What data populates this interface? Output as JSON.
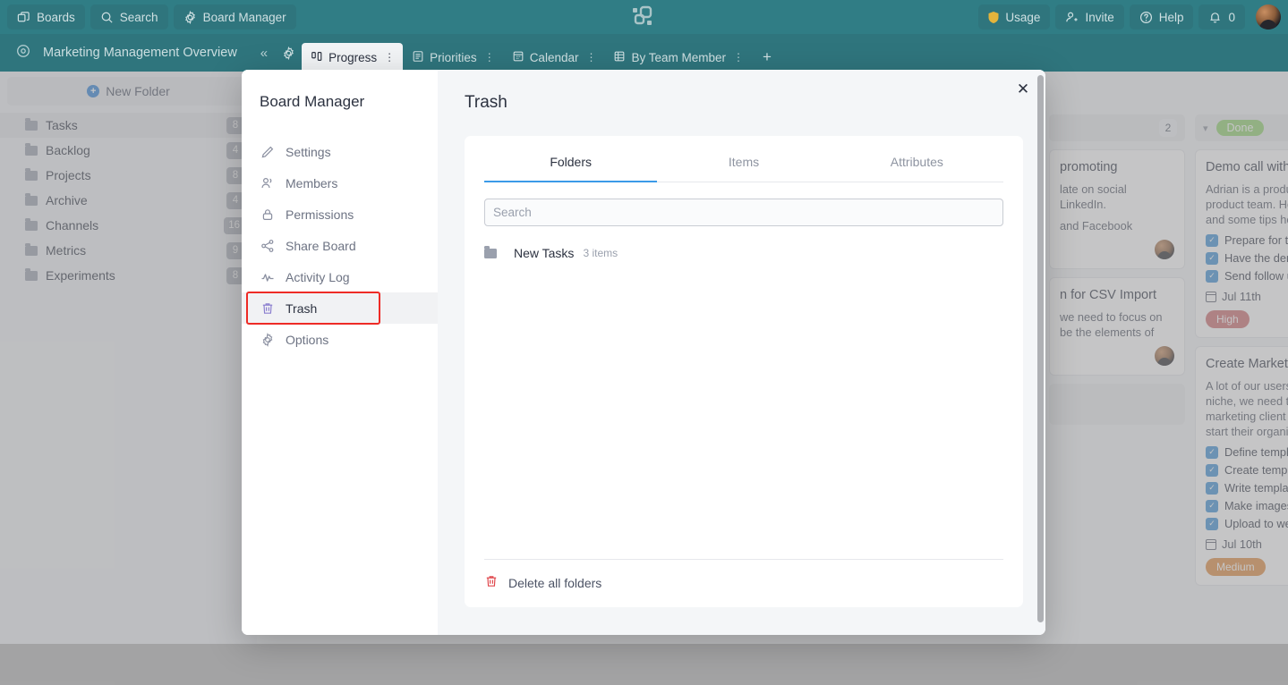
{
  "topbar": {
    "buttons": [
      {
        "label": "Boards",
        "icon": "boards-icon"
      },
      {
        "label": "Search",
        "icon": "search-icon"
      },
      {
        "label": "Board Manager",
        "icon": "gear-icon"
      }
    ],
    "right": [
      {
        "label": "Usage",
        "icon": "shield-icon"
      },
      {
        "label": "Invite",
        "icon": "user-plus-icon"
      },
      {
        "label": "Help",
        "icon": "question-circle-icon"
      },
      {
        "label": "0",
        "icon": "bell-icon"
      }
    ],
    "logo": "app-logo",
    "avatar": "user-avatar",
    "accent": "#307d85"
  },
  "subbar": {
    "board_title": "Marketing Management Overview",
    "collapse_icon": "«",
    "eye_icon": "eye-icon",
    "gear_icon": "gear-icon",
    "add_view_label": "+",
    "views": [
      {
        "label": "Progress",
        "icon": "kanban-icon",
        "active": true
      },
      {
        "label": "Priorities",
        "icon": "list-icon",
        "active": false
      },
      {
        "label": "Calendar",
        "icon": "calendar-icon",
        "active": false
      },
      {
        "label": "By Team Member",
        "icon": "table-icon",
        "active": false
      }
    ]
  },
  "sidebar": {
    "new_folder_label": "New Folder",
    "folders": [
      {
        "name": "Tasks",
        "count": "8"
      },
      {
        "name": "Backlog",
        "count": "4"
      },
      {
        "name": "Projects",
        "count": "8"
      },
      {
        "name": "Archive",
        "count": "4"
      },
      {
        "name": "Channels",
        "count": "16"
      },
      {
        "name": "Metrics",
        "count": "9"
      },
      {
        "name": "Experiments",
        "count": "8"
      }
    ]
  },
  "board": {
    "col_partial": {
      "count": "2"
    },
    "col_done": {
      "status": "Done"
    },
    "cards": [
      {
        "title": "promoting",
        "body_line1": "late on social",
        "body_line2": "LinkedIn.",
        "body_line3": "and Facebook"
      },
      {
        "title": "n for CSV Import",
        "body_line1": "we need to focus on",
        "body_line2": "be the elements of"
      },
      {
        "title": "Demo call with ",
        "body_line1": "Adrian is a produc",
        "body_line2": "product team. He",
        "body_line3": "and some tips how",
        "checklist": [
          "Prepare for the",
          "Have the demo",
          "Send follow up"
        ],
        "date": "Jul 11th",
        "priority": "High"
      },
      {
        "title": "Create Marketin",
        "body_line1": "A lot of our users",
        "body_line2": "niche, we need to",
        "body_line3": "marketing client te",
        "body_line4": "start their organiz",
        "checklist": [
          "Define templat",
          "Create templat",
          "Write template",
          "Make images",
          "Upload to web"
        ],
        "date": "Jul 10th",
        "priority": "Medium"
      }
    ]
  },
  "modal": {
    "title": "Board Manager",
    "close_label": "✕",
    "nav": [
      {
        "label": "Settings",
        "icon": "pencil-icon",
        "active": false
      },
      {
        "label": "Members",
        "icon": "members-icon",
        "active": false
      },
      {
        "label": "Permissions",
        "icon": "lock-icon",
        "active": false
      },
      {
        "label": "Share Board",
        "icon": "share-icon",
        "active": false
      },
      {
        "label": "Activity Log",
        "icon": "activity-icon",
        "active": false
      },
      {
        "label": "Trash",
        "icon": "trash-icon",
        "active": true
      },
      {
        "label": "Options",
        "icon": "gear-icon",
        "active": false
      }
    ],
    "highlighted_nav": "Trash",
    "highlight_color": "#ee2b26",
    "page_title": "Trash",
    "tabs": [
      {
        "label": "Folders",
        "active": true
      },
      {
        "label": "Items",
        "active": false
      },
      {
        "label": "Attributes",
        "active": false
      }
    ],
    "active_tab_color": "#3b9ae8",
    "search": {
      "value": "",
      "placeholder": "Search"
    },
    "trash_items": [
      {
        "name": "New Tasks",
        "meta": "3 items",
        "icon": "folder-icon"
      }
    ],
    "footer_action": {
      "label": "Delete all folders",
      "icon": "trash-icon",
      "color": "#e0474c"
    }
  }
}
